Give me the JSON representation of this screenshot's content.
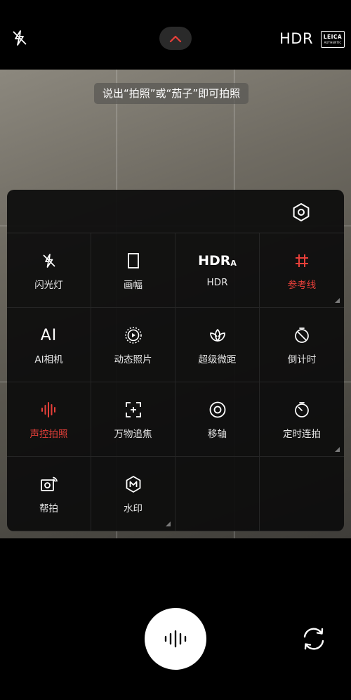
{
  "top_bar": {
    "hdr_label": "HDR",
    "leica_line1": "LEICA",
    "leica_line2": "AUTHENTIC",
    "flash_icon": "flash-off-icon",
    "chevron_icon": "chevron-up-icon"
  },
  "voice_hint": "说出“拍照”或“茄子”即可拍照",
  "panel": {
    "settings_icon": "settings-hexagon-icon",
    "items": [
      {
        "label": "闪光灯",
        "icon": "flash-off-icon",
        "active": false,
        "has_more": false
      },
      {
        "label": "画幅",
        "icon": "aspect-ratio-icon",
        "active": false,
        "has_more": false
      },
      {
        "label": "HDR",
        "icon": "hdr-auto-icon",
        "icon_text": "HDR",
        "icon_sub": "A",
        "active": false,
        "has_more": false
      },
      {
        "label": "参考线",
        "icon": "grid-lines-icon",
        "active": true,
        "has_more": true
      },
      {
        "label": "AI相机",
        "icon": "ai-icon",
        "icon_text": "AI",
        "active": false,
        "has_more": false
      },
      {
        "label": "动态照片",
        "icon": "motion-photo-icon",
        "active": false,
        "has_more": false
      },
      {
        "label": "超级微距",
        "icon": "macro-flower-icon",
        "active": false,
        "has_more": false
      },
      {
        "label": "倒计时",
        "icon": "timer-off-icon",
        "active": false,
        "has_more": false
      },
      {
        "label": "声控拍照",
        "icon": "voice-wave-icon",
        "active": true,
        "has_more": false
      },
      {
        "label": "万物追焦",
        "icon": "focus-track-icon",
        "active": false,
        "has_more": false
      },
      {
        "label": "移轴",
        "icon": "tilt-shift-icon",
        "active": false,
        "has_more": false
      },
      {
        "label": "定时连拍",
        "icon": "timed-burst-icon",
        "active": false,
        "has_more": true
      },
      {
        "label": "帮拍",
        "icon": "assist-shoot-icon",
        "active": false,
        "has_more": false
      },
      {
        "label": "水印",
        "icon": "watermark-icon",
        "active": false,
        "has_more": true
      }
    ]
  },
  "bottom": {
    "shutter_icon": "voice-wave-icon",
    "switch_icon": "switch-camera-icon"
  },
  "colors": {
    "accent_red": "#e8403a",
    "panel_bg": "#0c0c0c"
  }
}
